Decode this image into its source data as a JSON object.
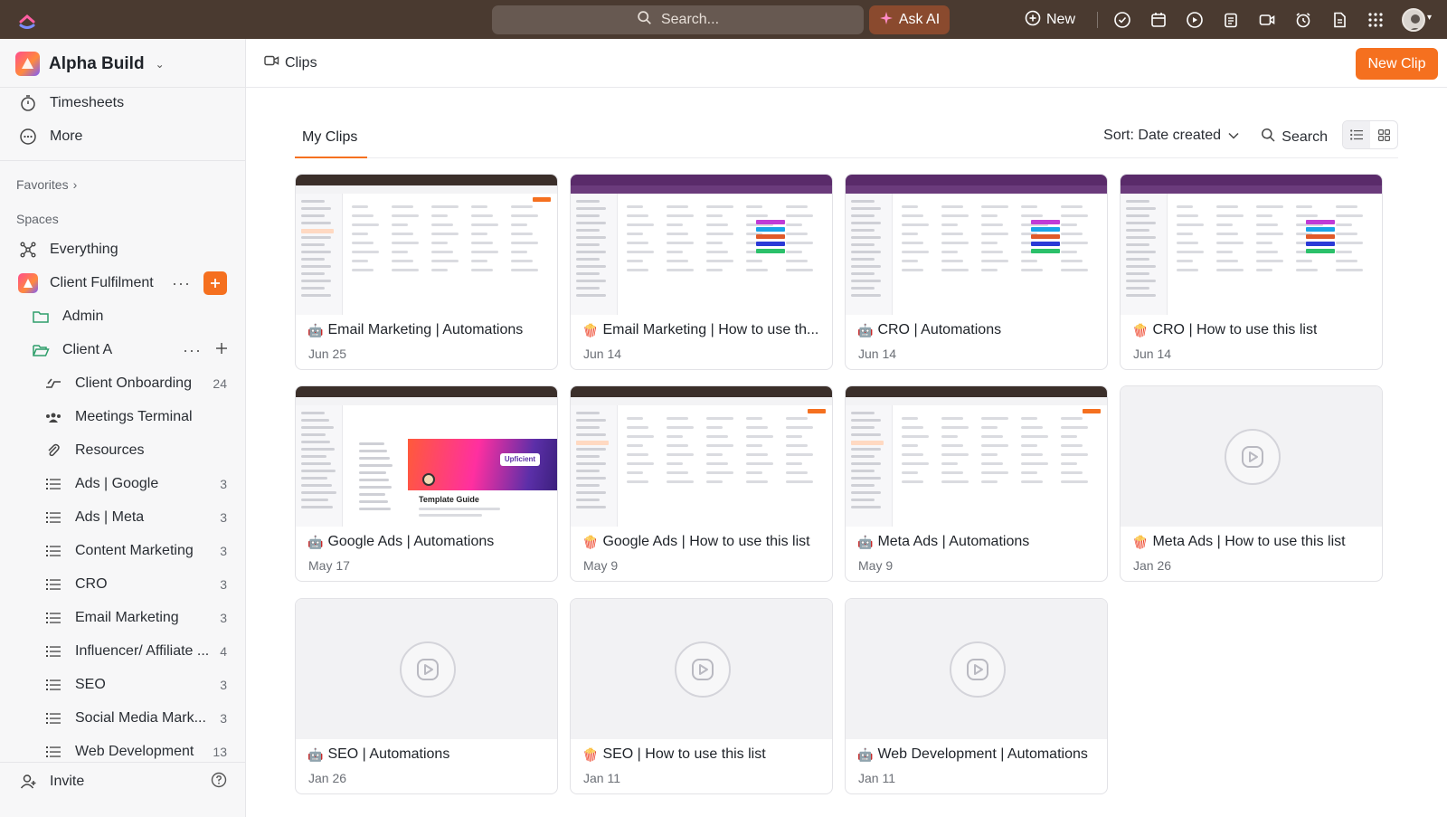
{
  "topbar": {
    "search_placeholder": "Search...",
    "ask_ai_label": "Ask AI",
    "new_label": "New"
  },
  "sidebar": {
    "workspace_name": "Alpha Build",
    "top_items": [
      {
        "label": "Timesheets",
        "icon": "timesheets-icon"
      },
      {
        "label": "More",
        "icon": "more-icon"
      }
    ],
    "favorites_label": "Favorites",
    "spaces_label": "Spaces",
    "everything_label": "Everything",
    "space_name": "Client Fulfilment",
    "folders": [
      {
        "label": "Admin"
      },
      {
        "label": "Client A"
      }
    ],
    "lists": [
      {
        "label": "Client Onboarding",
        "count": "24",
        "icon": "onboarding-icon"
      },
      {
        "label": "Meetings Terminal",
        "count": "",
        "icon": "meetings-icon"
      },
      {
        "label": "Resources",
        "count": "",
        "icon": "attachment-icon"
      },
      {
        "label": "Ads | Google",
        "count": "3",
        "icon": "list-icon"
      },
      {
        "label": "Ads | Meta",
        "count": "3",
        "icon": "list-icon"
      },
      {
        "label": "Content Marketing",
        "count": "3",
        "icon": "list-icon"
      },
      {
        "label": "CRO",
        "count": "3",
        "icon": "list-icon"
      },
      {
        "label": "Email Marketing",
        "count": "3",
        "icon": "list-icon"
      },
      {
        "label": "Influencer/ Affiliate ...",
        "count": "4",
        "icon": "list-icon"
      },
      {
        "label": "SEO",
        "count": "3",
        "icon": "list-icon"
      },
      {
        "label": "Social Media Mark...",
        "count": "3",
        "icon": "list-icon"
      },
      {
        "label": "Web Development",
        "count": "13",
        "icon": "list-icon"
      }
    ],
    "invite_label": "Invite"
  },
  "main": {
    "breadcrumb": "Clips",
    "new_clip_label": "New Clip",
    "tab_label": "My Clips",
    "sort_label": "Sort: Date created",
    "search_label": "Search"
  },
  "clips": [
    {
      "emoji": "🤖",
      "title": "Email Marketing | Automations",
      "date": "Jun 25",
      "thumb": "dark"
    },
    {
      "emoji": "🍿",
      "title": "Email Marketing | How to use th...",
      "date": "Jun 14",
      "thumb": "purple"
    },
    {
      "emoji": "🤖",
      "title": "CRO | Automations",
      "date": "Jun 14",
      "thumb": "purple"
    },
    {
      "emoji": "🍿",
      "title": "CRO | How to use this list",
      "date": "Jun 14",
      "thumb": "purple"
    },
    {
      "emoji": "🤖",
      "title": "Google Ads | Automations",
      "date": "May 17",
      "thumb": "template"
    },
    {
      "emoji": "🍿",
      "title": "Google Ads | How to use this list",
      "date": "May 9",
      "thumb": "dark"
    },
    {
      "emoji": "🤖",
      "title": "Meta Ads | Automations",
      "date": "May 9",
      "thumb": "dark"
    },
    {
      "emoji": "🍿",
      "title": "Meta Ads | How to use this list",
      "date": "Jan 26",
      "thumb": "none"
    },
    {
      "emoji": "🤖",
      "title": "SEO | Automations",
      "date": "Jan 26",
      "thumb": "none"
    },
    {
      "emoji": "🍿",
      "title": "SEO | How to use this list",
      "date": "Jan 11",
      "thumb": "none"
    },
    {
      "emoji": "🤖",
      "title": "Web Development | Automations",
      "date": "Jan 11",
      "thumb": "none"
    }
  ],
  "template_thumb": {
    "heading": "Template Guide",
    "brand": "Upficient"
  },
  "colors": {
    "accent": "#f5701f",
    "topbar": "#4a3a30",
    "ask_ai": "#8a4a2e"
  }
}
